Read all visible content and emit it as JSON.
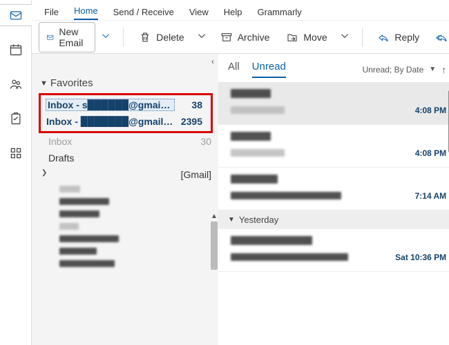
{
  "menubar": {
    "items": [
      "File",
      "Home",
      "Send / Receive",
      "View",
      "Help",
      "Grammarly"
    ],
    "activeIndex": 1
  },
  "ribbon": {
    "new_email": "New Email",
    "delete": "Delete",
    "archive": "Archive",
    "move": "Move",
    "reply": "Reply"
  },
  "nav": {
    "favorites_label": "Favorites",
    "fav_items": [
      {
        "label": "Inbox - s██████@gmail....",
        "count": "38",
        "selected": true
      },
      {
        "label": "Inbox - ███████@gmail.c...",
        "count": "2395",
        "selected": false
      }
    ],
    "folders": [
      {
        "label": "Inbox",
        "count": "30"
      },
      {
        "label": "Drafts",
        "count": ""
      },
      {
        "label": "[Gmail]",
        "count": "",
        "expandable": true
      }
    ]
  },
  "list": {
    "tabs": {
      "all": "All",
      "unread": "Unread",
      "activeIndex": 1
    },
    "sort_label": "Unread; By Date",
    "messages": [
      {
        "time": "4:08 PM",
        "selected": true
      },
      {
        "time": "4:08 PM"
      },
      {
        "time": "7:14 AM"
      }
    ],
    "group_header": "Yesterday",
    "yesterday_messages": [
      {
        "time": "Sat 10:36 PM"
      }
    ]
  }
}
